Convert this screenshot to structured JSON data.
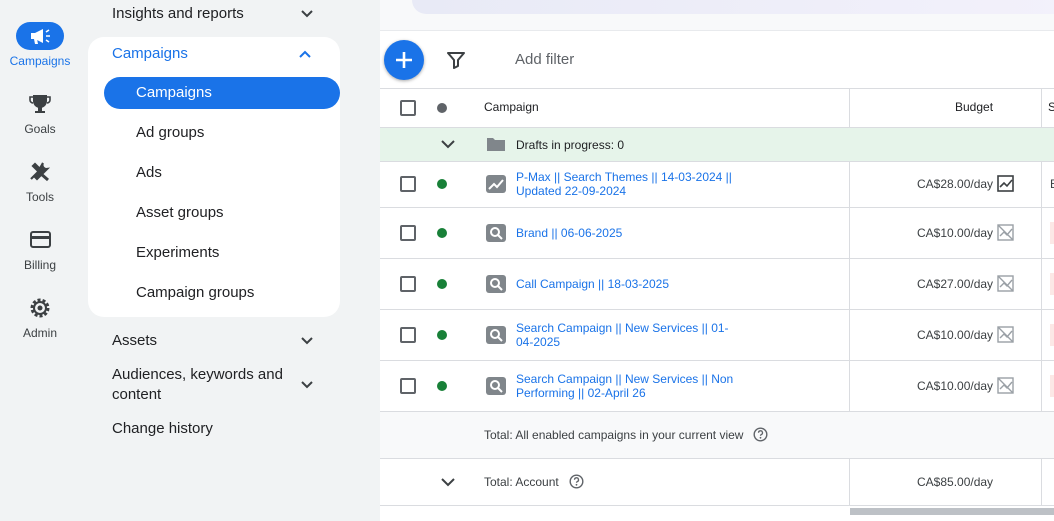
{
  "rail": {
    "items": [
      {
        "label": "Campaigns",
        "icon": "megaphone-icon",
        "active": true
      },
      {
        "label": "Goals",
        "icon": "trophy-icon"
      },
      {
        "label": "Tools",
        "icon": "tools-icon"
      },
      {
        "label": "Billing",
        "icon": "credit-card-icon"
      },
      {
        "label": "Admin",
        "icon": "gear-icon"
      }
    ]
  },
  "nav": {
    "insights": "Insights and reports",
    "campaigns_section": "Campaigns",
    "sub_items": [
      "Campaigns",
      "Ad groups",
      "Ads",
      "Asset groups",
      "Experiments",
      "Campaign groups"
    ],
    "assets": "Assets",
    "audiences_line1": "Audiences, keywords and",
    "audiences_line2": "content",
    "change_history": "Change history"
  },
  "toolbar": {
    "add_filter": "Add filter"
  },
  "table": {
    "col_campaign": "Campaign",
    "col_budget": "Budget",
    "col_next_initial": "S",
    "drafts": "Drafts in progress: 0",
    "rows": [
      {
        "name_l1": "P-Max || Search Themes || 14-03-2024 ||",
        "name_l2": "Updated 22-09-2024",
        "budget": "CA$28.00/day",
        "type_icon": "performance-max-icon",
        "right_initial": "E"
      },
      {
        "name_l1": "Brand || 06-06-2025",
        "name_l2": "",
        "budget": "CA$10.00/day",
        "type_icon": "search-campaign-icon",
        "right_initial": ""
      },
      {
        "name_l1": "Call Campaign || 18-03-2025",
        "name_l2": "",
        "budget": "CA$27.00/day",
        "type_icon": "search-campaign-icon",
        "right_initial": ""
      },
      {
        "name_l1": "Search Campaign || New Services || 01-",
        "name_l2": "04-2025",
        "budget": "CA$10.00/day",
        "type_icon": "search-campaign-icon",
        "right_initial": ""
      },
      {
        "name_l1": "Search Campaign || New Services || Non",
        "name_l2": "Performing || 02-April 26",
        "budget": "CA$10.00/day",
        "type_icon": "search-campaign-icon",
        "right_initial": ""
      }
    ],
    "total_enabled": "Total: All enabled campaigns in your current view",
    "total_account": "Total: Account",
    "total_account_budget": "CA$85.00/day"
  },
  "colors": {
    "accent": "#1a73e8",
    "enabled": "#188038",
    "drafts_bg": "#e6f4ea"
  }
}
